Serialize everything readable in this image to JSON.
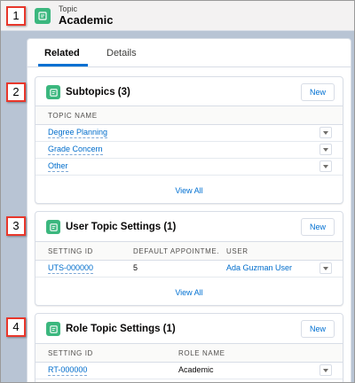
{
  "header": {
    "object_label": "Topic",
    "record_name": "Academic"
  },
  "callouts": [
    "1",
    "2",
    "3",
    "4"
  ],
  "tabs": [
    {
      "label": "Related",
      "active": true
    },
    {
      "label": "Details",
      "active": false
    }
  ],
  "subtopics": {
    "title": "Subtopics (3)",
    "new_label": "New",
    "columns": [
      "TOPIC NAME"
    ],
    "rows": [
      {
        "topic_name": "Degree Planning"
      },
      {
        "topic_name": "Grade Concern"
      },
      {
        "topic_name": "Other"
      }
    ],
    "view_all": "View All"
  },
  "user_topic_settings": {
    "title": "User Topic Settings (1)",
    "new_label": "New",
    "columns": [
      "SETTING ID",
      "DEFAULT APPOINTME...",
      "USER"
    ],
    "rows": [
      {
        "setting_id": "UTS-000000",
        "default_appointment": "5",
        "user": "Ada Guzman User"
      }
    ],
    "view_all": "View All"
  },
  "role_topic_settings": {
    "title": "Role Topic Settings (1)",
    "new_label": "New",
    "columns": [
      "SETTING ID",
      "ROLE NAME"
    ],
    "rows": [
      {
        "setting_id": "RT-000000",
        "role_name": "Academic"
      }
    ]
  },
  "colors": {
    "accent": "#0070d2",
    "topic_icon": "#3bb77e",
    "callout_border": "#e8372b"
  },
  "icons": {
    "topic": "topic-icon",
    "row_menu": "chevron-down-icon"
  }
}
